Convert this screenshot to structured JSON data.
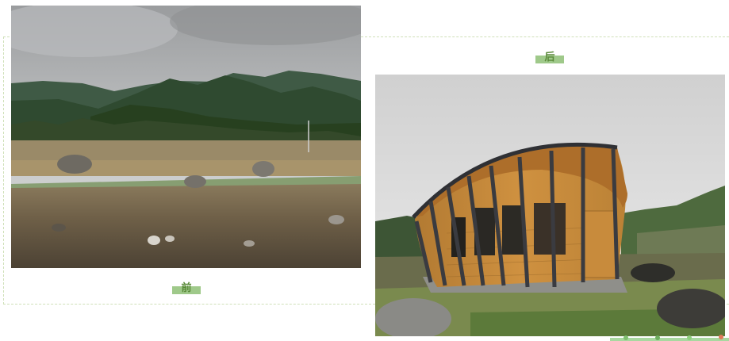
{
  "labels": {
    "before": "前",
    "after": "后"
  },
  "colors": {
    "label_bg": "#9fc98a",
    "label_text": "#5a8a3a",
    "frame_border": "#cfe0b8"
  }
}
